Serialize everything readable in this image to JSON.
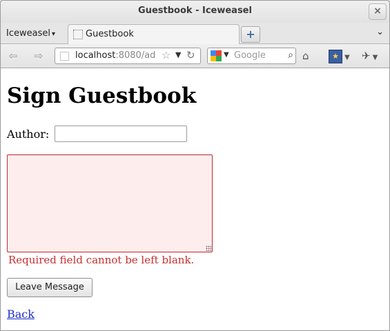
{
  "window": {
    "title": "Guestbook - Iceweasel",
    "close_glyph": "×"
  },
  "tabbar": {
    "app_menu_label": "Iceweasel",
    "tab_label": "Guestbook",
    "new_tab_glyph": "+",
    "tab_list_glyph": "⌄"
  },
  "navbar": {
    "url_host": "localhost",
    "url_rest": ":8080/ad",
    "search_placeholder": "Google",
    "icons": [
      "back-icon",
      "forward-icon",
      "page-icon",
      "bookmark-star-icon",
      "history-dropdown-icon",
      "reload-icon",
      "google-engine-icon",
      "search-icon",
      "home-icon",
      "bookmarks-icon",
      "addons-icon"
    ],
    "engine_colors": [
      "#4285f4",
      "#ea4335",
      "#fbbc05",
      "#34a853"
    ]
  },
  "page": {
    "heading": "Sign Guestbook",
    "author_label": "Author:",
    "author_value": "",
    "message_value": "",
    "error_text": "Required field cannot be left blank.",
    "error_color": "#c62f2f",
    "submit_label": "Leave Message",
    "back_link": "Back",
    "link_color": "#1a2ecc"
  }
}
